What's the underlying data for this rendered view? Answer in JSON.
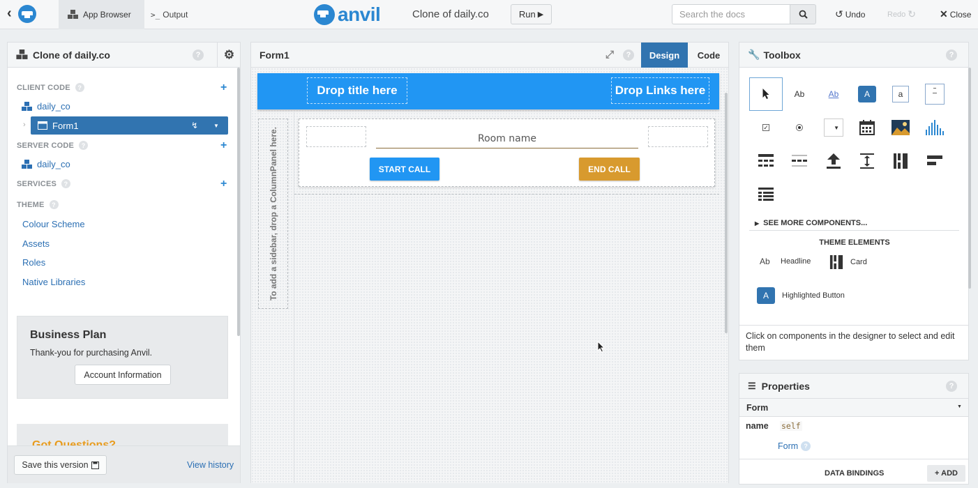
{
  "topbar": {
    "app_browser": "App Browser",
    "output": "Output",
    "logo_text": "anvil",
    "app_name": "Clone of daily.co",
    "run": "Run",
    "search_placeholder": "Search the docs",
    "undo": "Undo",
    "redo": "Redo",
    "close": "Close"
  },
  "left": {
    "title": "Clone of daily.co",
    "client_code": "CLIENT CODE",
    "client_module": "daily_co",
    "form1": "Form1",
    "server_code": "SERVER CODE",
    "server_module": "daily_co",
    "services": "SERVICES",
    "theme": "THEME",
    "theme_links": [
      "Colour Scheme",
      "Assets",
      "Roles",
      "Native Libraries"
    ],
    "plan": {
      "title": "Business Plan",
      "text": "Thank-you for purchasing Anvil.",
      "button": "Account Information"
    },
    "questions": "Got Questions?",
    "save_version": "Save this version",
    "view_history": "View history"
  },
  "center": {
    "title": "Form1",
    "design_tab": "Design",
    "code_tab": "Code",
    "drop_title": "Drop title here",
    "drop_links": "Drop Links here",
    "sidebar_hint": "To add a sidebar, drop a ColumnPanel here.",
    "room_name": "Room name",
    "start_call": "START CALL",
    "end_call": "END CALL"
  },
  "toolbox": {
    "title": "Toolbox",
    "tools": [
      "pointer",
      "label",
      "link",
      "button",
      "textbox",
      "textarea",
      "checkbox",
      "radio",
      "dropdown",
      "datepicker",
      "image",
      "plot",
      "data-grid",
      "repeating-panel",
      "file-loader",
      "spacer",
      "column-panel",
      "flow-panel",
      "rich-text"
    ],
    "label_glyph": "Ab",
    "link_glyph": "Ab",
    "button_glyph": "A",
    "textbox_glyph": "a",
    "see_more": "SEE MORE COMPONENTS...",
    "theme_elements": "THEME ELEMENTS",
    "headline": "Headline",
    "card": "Card",
    "highlighted_button": "Highlighted Button",
    "help": "Click on components in the designer to select and edit them",
    "colors": {
      "accent": "#3174b0",
      "blue": "#2196f3",
      "plot": "#2b87d1"
    }
  },
  "properties": {
    "title": "Properties",
    "selected": "Form",
    "name_label": "name",
    "name_value": "self",
    "form_link": "Form",
    "data_bindings": "DATA BINDINGS",
    "add": "+ ADD"
  },
  "colors": {
    "accent": "#3174b0",
    "title_bar": "#2196f3",
    "end_call": "#d89a2e",
    "link": "#2b6fb3"
  }
}
